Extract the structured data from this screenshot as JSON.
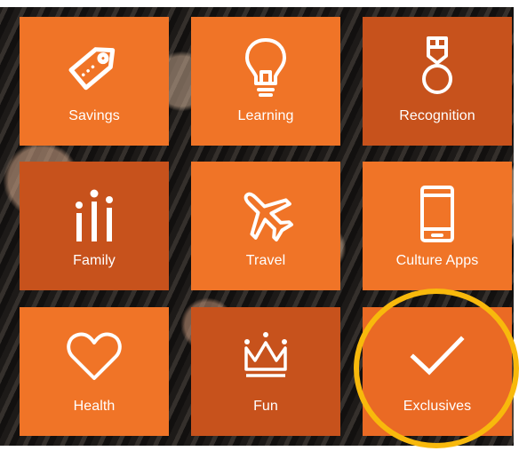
{
  "tiles": [
    {
      "label": "Savings",
      "icon": "tag-icon",
      "color": "#f07427"
    },
    {
      "label": "Learning",
      "icon": "lightbulb-icon",
      "color": "#f07427"
    },
    {
      "label": "Recognition",
      "icon": "medal-icon",
      "color": "#c7521c"
    },
    {
      "label": "Family",
      "icon": "family-icon",
      "color": "#c7521c"
    },
    {
      "label": "Travel",
      "icon": "airplane-icon",
      "color": "#f07427"
    },
    {
      "label": "Culture Apps",
      "icon": "smartphone-icon",
      "color": "#f07427"
    },
    {
      "label": "Health",
      "icon": "heart-icon",
      "color": "#f07427"
    },
    {
      "label": "Fun",
      "icon": "crown-icon",
      "color": "#c7521c"
    },
    {
      "label": "Exclusives",
      "icon": "checkmark-icon",
      "color": "#ea6a24"
    }
  ],
  "highlight": {
    "target": "Exclusives",
    "color": "#f8b90c"
  }
}
